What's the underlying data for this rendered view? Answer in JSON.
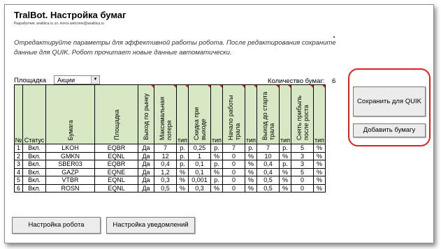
{
  "header": {
    "title": "TralBot. Настройка бумаг",
    "subtitle": "Разработчик: analitica.ru эл. почта welcome@analitica.ru"
  },
  "description": "Отредактируйте параметры для эффективной работы робота. После редактирования сохраните данные для QUIK. Робот прочитает новые данные автоматически.",
  "area": {
    "label": "Площадка",
    "selected": "Акции"
  },
  "count": {
    "label": "Количество бумаг:",
    "value": "6"
  },
  "table": {
    "headers": [
      "№",
      "Статус",
      "Бумага",
      "Площадка",
      "Выход по рынку",
      "Максимальная потеря",
      "тип",
      "Скидка при выходе",
      "тип",
      "Начало работы трала",
      "тип",
      "Выход до старта трала",
      "тип",
      "Снять прибыль после роста",
      "тип"
    ],
    "rows": [
      [
        "1",
        "Вкл.",
        "LKOH",
        "EQBR",
        "Да",
        "7",
        "р.",
        "0,25",
        "р.",
        "7",
        "р.",
        "7",
        "р.",
        "5",
        "%"
      ],
      [
        "2",
        "Вкл.",
        "GMKN",
        "EQNL",
        "Да",
        "12",
        "р.",
        "1",
        "%",
        "0",
        "%",
        "10",
        "%",
        "3",
        "%"
      ],
      [
        "3",
        "Вкл.",
        "SBER03",
        "EQBR",
        "Да",
        "0,4",
        "р.",
        "0,1",
        "р.",
        "0",
        "%",
        "0,4",
        "р.",
        "3",
        "%"
      ],
      [
        "4",
        "Вкл.",
        "GAZP",
        "EQNE",
        "Да",
        "1,2",
        "%",
        "0,1",
        "%",
        "0",
        "%",
        "0,4",
        "%",
        "5",
        "%"
      ],
      [
        "5",
        "Вкл.",
        "VTBR",
        "EQNL",
        "Да",
        "0,3",
        "%",
        "0,001",
        "р.",
        "0",
        "%",
        "0,5",
        "%",
        "0",
        "%"
      ],
      [
        "6",
        "Вкл.",
        "ROSN",
        "EQNL",
        "Да",
        "0,5",
        "%",
        "0,3",
        "%",
        "0",
        "%",
        "0,5",
        "%",
        "0",
        "%"
      ]
    ]
  },
  "buttons": {
    "save": "Сохранить для QUIK",
    "add": "Добавить бумагу",
    "robot_settings": "Настройка робота",
    "notify_settings": "Настройка уведомлений"
  },
  "colors": {
    "header_bg": "#d7e9c4",
    "highlight": "#e02020"
  }
}
